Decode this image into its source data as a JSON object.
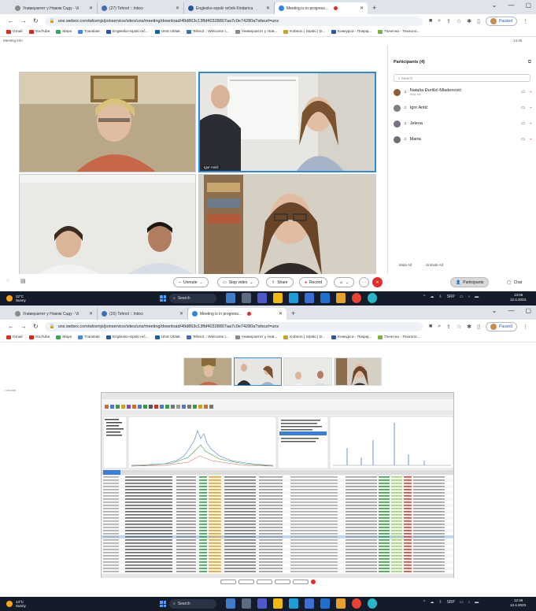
{
  "shot1": {
    "tabs": [
      {
        "label": "Универзитет у Новом Саду - Vi",
        "color": "#8a8a8a"
      },
      {
        "label": "(27) Tehnol :: Inbox",
        "color": "#3d6fb6"
      },
      {
        "label": "Englesko-srpski rečnik Kindarica",
        "color": "#2457a0"
      },
      {
        "label": "Meeting is in progress...",
        "color": "#2e86de"
      }
    ],
    "url": "uns.webex.com/wbxmjs/joinservice/sites/uns/meeting/download/49d863c13fbf40328807aa7c0e74280a?siteurl=uns",
    "profile_status": "Paused",
    "bookmarks": [
      {
        "label": "Gmail",
        "color": "#d93025"
      },
      {
        "label": "YouTube",
        "color": "#e62117"
      },
      {
        "label": "Maps",
        "color": "#34a853"
      },
      {
        "label": "Translate",
        "color": "#4285f4"
      },
      {
        "label": "Englesko-srpski reč...",
        "color": "#2457a0"
      },
      {
        "label": "UNS Oblak",
        "color": "#1b5fa8"
      },
      {
        "label": "Tehnol :: Welcome t...",
        "color": "#3d6fb6"
      },
      {
        "label": "Универзитет у Нов...",
        "color": "#8a8a8a"
      },
      {
        "label": "Kobson | Srpski | D...",
        "color": "#c9a227"
      },
      {
        "label": "Конкурси - Покрај...",
        "color": "#2c5aa0"
      },
      {
        "label": "Почетна - Техноло...",
        "color": "#7bb03a"
      }
    ],
    "meeting_info": "Meeting Info",
    "time_right": "14:46",
    "active_tile_name": "Igor Antić",
    "participants": {
      "header": "Participants (4)",
      "search_placeholder": "Search",
      "list": [
        {
          "name": "Nataša Đurišić-Mladenović",
          "sub": "Host, me",
          "avatar_color": "#8c5c3c"
        },
        {
          "name": "Igor Antić",
          "sub": "",
          "avatar_color": "#7f7f7f"
        },
        {
          "name": "Jelena",
          "sub": "",
          "avatar_color": "#7a6f8a"
        },
        {
          "name": "Marta",
          "sub": "",
          "avatar_color": "#6f6f6f"
        }
      ],
      "mute_all": "Mute All",
      "unmute_all": "Unmute All"
    },
    "controls": {
      "unmute": "Unmute",
      "stop_video": "Stop video",
      "share": "Share",
      "record": "Record",
      "participants": "Participants",
      "chat": "Chat"
    },
    "taskbar": {
      "temp": "12°C",
      "weather": "Sunny",
      "search": "Search",
      "lang": "SRP",
      "time": "13:05",
      "date": "12.4.2023."
    }
  },
  "shot2": {
    "tabs": [
      {
        "label": "Универзитет у Новом Саду - Vi",
        "color": "#8a8a8a"
      },
      {
        "label": "(26) Tehnol :: Inbox",
        "color": "#3d6fb6"
      },
      {
        "label": "Meeting is in progress...",
        "color": "#2e86de"
      }
    ],
    "url": "uns.webex.com/wbxmjs/joinservice/sites/uns/meeting/download/49d863c13fbf40328807aa7c0e74280a?siteurl=uns",
    "profile_status": "Paused",
    "taskbar": {
      "temp": "14°C",
      "weather": "Sunny",
      "search": "Search",
      "lang": "SRP",
      "time": "12:46",
      "date": "12.4.2023."
    }
  }
}
